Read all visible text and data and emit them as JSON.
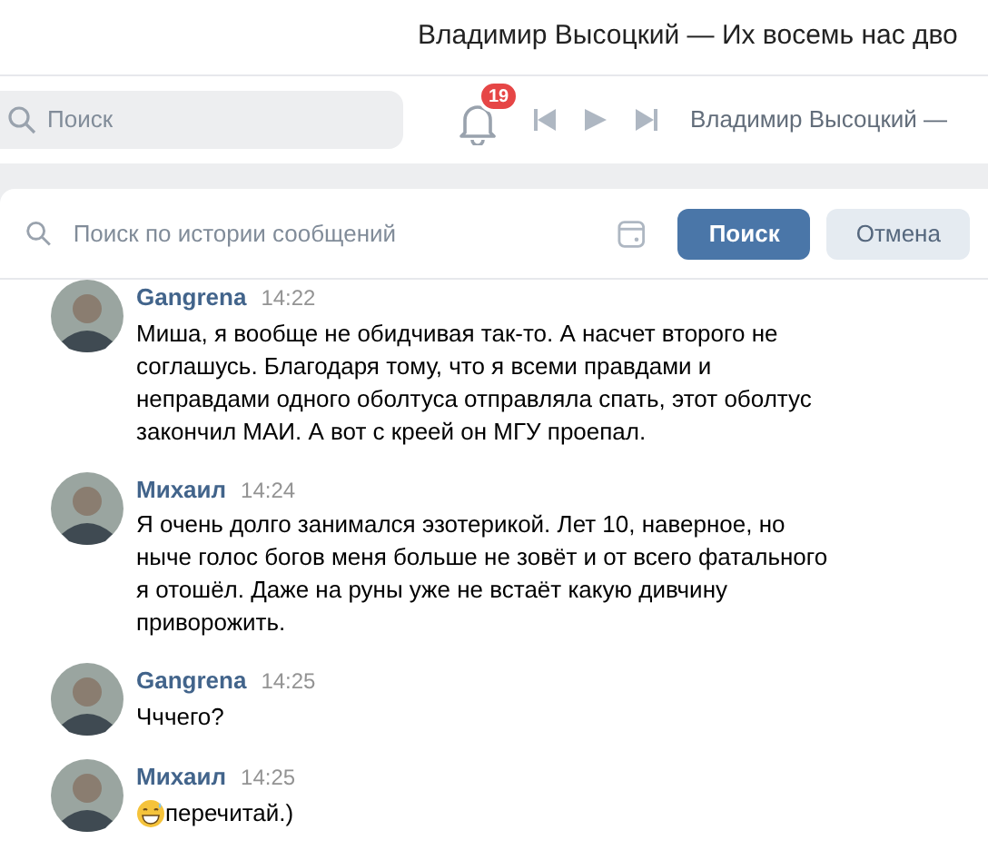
{
  "window": {
    "title": "Владимир Высоцкий — Их восемь нас дво"
  },
  "header": {
    "search": {
      "placeholder": "Поиск"
    },
    "notifications": {
      "count": "19"
    },
    "player": {
      "track": "Владимир Высоцкий —"
    }
  },
  "history_search": {
    "placeholder": "Поиск по истории сообщений",
    "search_button": "Поиск",
    "cancel_button": "Отмена"
  },
  "messages": [
    {
      "author": "Gangrena",
      "time": "14:22",
      "text": "Миша, я вообще не обидчивая так-то. А насчет второго не соглашусь. Благодаря тому, что я всеми правдами и неправдами одного оболтуса отправляла спать, этот оболтус закончил МАИ. А вот с креей он МГУ проепал.",
      "emoji": false
    },
    {
      "author": "Михаил",
      "time": "14:24",
      "text": "Я очень долго занимался эзотерикой. Лет 10, наверное, но ныче голос богов меня больше не зовёт и от всего фатального я отошёл. Даже на руны уже не встаёт какую дивчину приворожить.",
      "emoji": false
    },
    {
      "author": "Gangrena",
      "time": "14:25",
      "text": "Чччего?",
      "emoji": false
    },
    {
      "author": "Михаил",
      "time": "14:25",
      "text": "перечитай.)",
      "emoji": true
    }
  ]
}
